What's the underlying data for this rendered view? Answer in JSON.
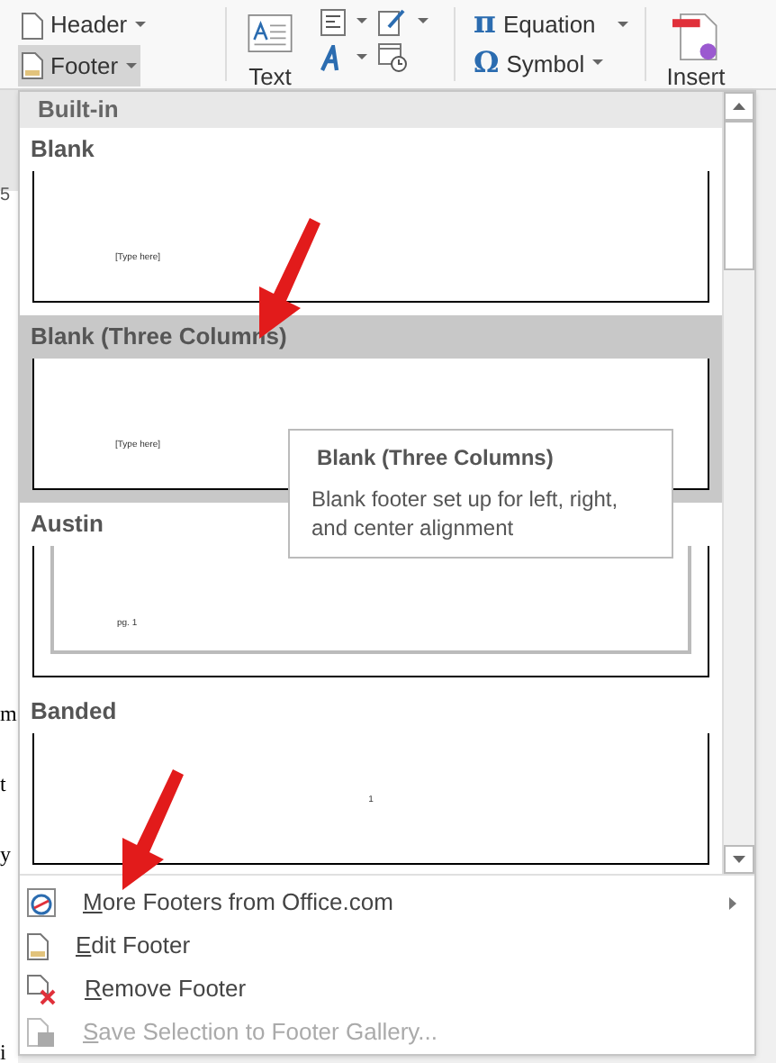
{
  "ribbon": {
    "header_button": {
      "label": "Header",
      "selected": false
    },
    "footer_button": {
      "label": "Footer",
      "selected": true
    },
    "text_button": {
      "label": "Text"
    },
    "equation_button": {
      "label": "Equation",
      "icon": "π"
    },
    "symbol_button": {
      "label": "Symbol",
      "icon": "Ω"
    },
    "insert_button": {
      "label": "Insert"
    }
  },
  "document": {
    "tab_number": "5",
    "fragments": [
      "m",
      "t",
      "y",
      "i"
    ]
  },
  "gallery": {
    "section": "Built-in",
    "items": [
      {
        "label": "Blank",
        "kind": "blank",
        "preview_text": "[Type here]",
        "selected": false
      },
      {
        "label": "Blank (Three Columns)",
        "kind": "blank",
        "preview_text": "[Type here]",
        "selected": true
      },
      {
        "label": "Austin",
        "kind": "framed",
        "preview_text": "pg. 1",
        "selected": false
      },
      {
        "label": "Banded",
        "kind": "centered",
        "preview_text": "1",
        "selected": false
      }
    ],
    "tooltip": {
      "title": "Blank (Three Columns)",
      "text": "Blank footer set up for left, right, and center alignment"
    }
  },
  "menu": [
    {
      "label": "More Footers from Office.com",
      "kind": "web",
      "submenu": true,
      "disabled": false
    },
    {
      "label": "Edit Footer",
      "kind": "edit",
      "submenu": false,
      "disabled": false
    },
    {
      "label": "Remove Footer",
      "kind": "remove",
      "submenu": false,
      "disabled": false
    },
    {
      "label": "Save Selection to Footer Gallery...",
      "kind": "save",
      "submenu": false,
      "disabled": true
    }
  ]
}
